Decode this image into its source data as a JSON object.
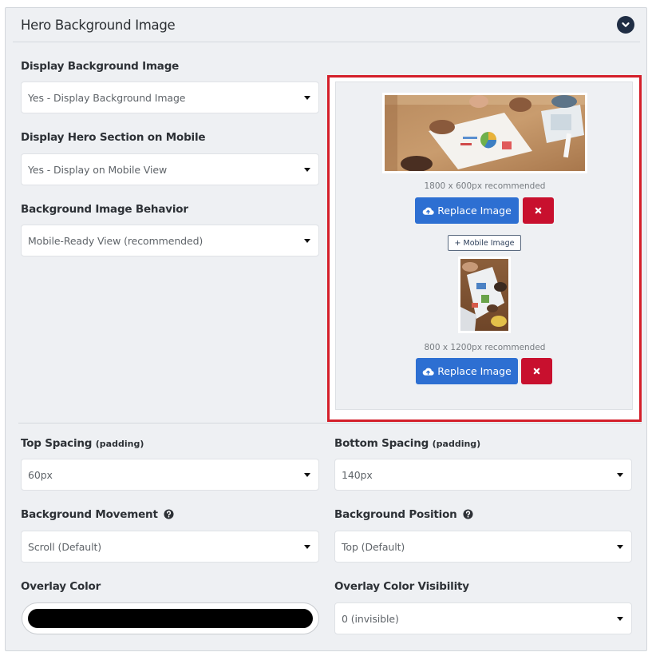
{
  "section": {
    "title": "Hero Background Image"
  },
  "display_background": {
    "label": "Display Background Image",
    "value": "Yes - Display Background Image"
  },
  "display_mobile": {
    "label": "Display Hero Section on Mobile",
    "value": "Yes - Display on Mobile View"
  },
  "behavior": {
    "label": "Background Image Behavior",
    "value": "Mobile-Ready View (recommended)"
  },
  "desktop_image": {
    "hint": "1800 x 600px recommended",
    "replace_label": "Replace Image"
  },
  "mobile_toggle": {
    "label": "+ Mobile Image"
  },
  "mobile_image": {
    "hint": "800 x 1200px recommended",
    "replace_label": "Replace Image"
  },
  "top_spacing": {
    "label": "Top Spacing",
    "note": "(padding)",
    "value": "60px"
  },
  "bottom_spacing": {
    "label": "Bottom Spacing",
    "note": "(padding)",
    "value": "140px"
  },
  "movement": {
    "label": "Background Movement",
    "value": "Scroll (Default)"
  },
  "position": {
    "label": "Background Position",
    "value": "Top (Default)"
  },
  "overlay_color": {
    "label": "Overlay Color",
    "value": "#000000"
  },
  "overlay_visibility": {
    "label": "Overlay Color Visibility",
    "value": "0 (invisible)"
  },
  "colors": {
    "primary": "#2d6fd2",
    "danger": "#c8102e",
    "highlight": "#d41f2a",
    "header_icon": "#1f2d44"
  },
  "icons": {
    "collapse": "chevron-down-icon",
    "upload": "cloud-upload-icon",
    "remove": "close-icon",
    "help": "question-circle-icon"
  }
}
